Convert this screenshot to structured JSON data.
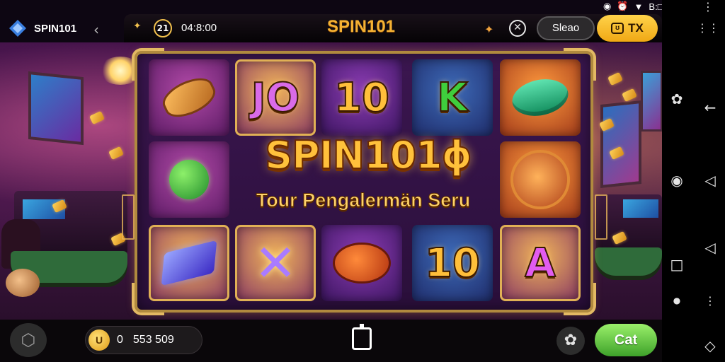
{
  "app": {
    "name": "SPIN101"
  },
  "status_bar": {
    "text": "B:□"
  },
  "hud": {
    "level": "21",
    "time": "04:8:00",
    "title": "SPIN101",
    "sleep_label": "Sleao",
    "tx_label": "TX"
  },
  "reels": {
    "row1": [
      "",
      "JO",
      "10",
      "K",
      ""
    ],
    "row3": [
      "",
      "",
      "",
      "10",
      "A"
    ]
  },
  "banner": {
    "title": "SPIN101ɸ",
    "subtitle": "Tour Pengalermän Seru"
  },
  "bottom": {
    "coin_icon_label": "U",
    "count": "0",
    "balance": "553 509",
    "cat_label": "Cat"
  },
  "icons": [
    "app-logo-icon",
    "back-icon",
    "star-icon",
    "soccer-icon",
    "tx-icon",
    "wifi-icon",
    "cube-icon",
    "coin-icon",
    "share-icon",
    "settings-icon",
    "home-icon",
    "back-nav-icon",
    "recent-icon"
  ]
}
